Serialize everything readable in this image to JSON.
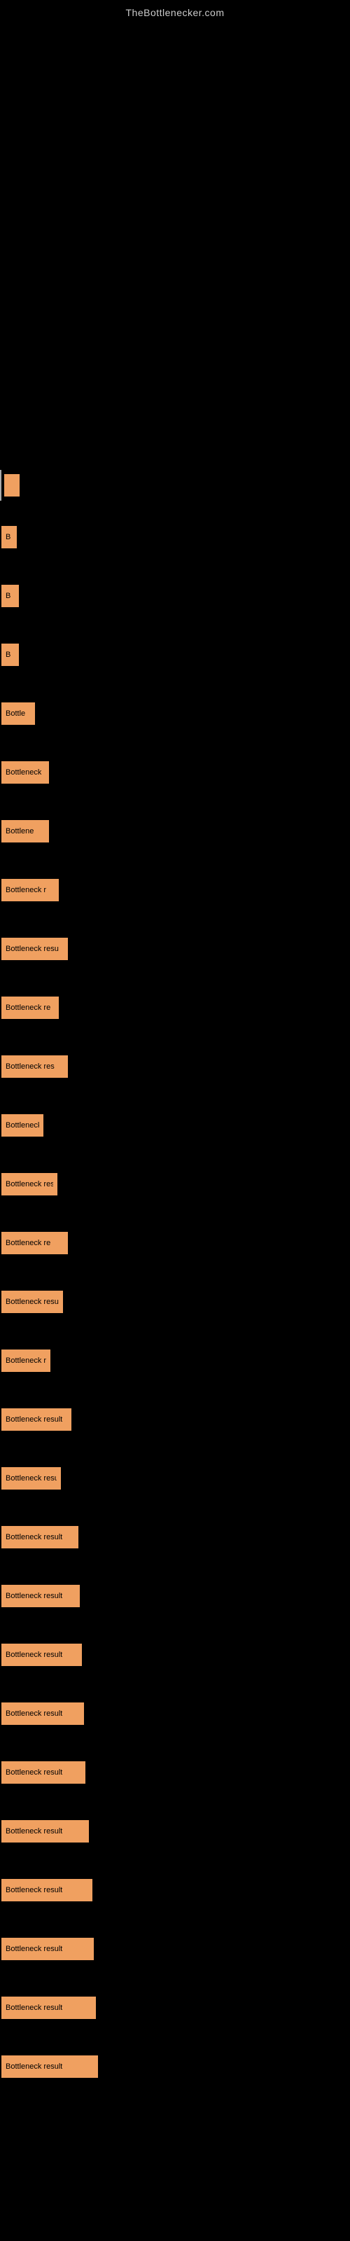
{
  "site": {
    "title": "TheBottlenecker.com"
  },
  "results": [
    {
      "id": 1,
      "label": "",
      "bar_class": "bar-w-1",
      "has_line": true,
      "spacer_before": 640
    },
    {
      "id": 2,
      "label": "B",
      "bar_class": "bar-w-1",
      "has_line": false,
      "spacer_before": 30
    },
    {
      "id": 3,
      "label": "B",
      "bar_class": "bar-w-2",
      "has_line": false,
      "spacer_before": 40
    },
    {
      "id": 4,
      "label": "B",
      "bar_class": "bar-w-2",
      "has_line": false,
      "spacer_before": 40
    },
    {
      "id": 5,
      "label": "Bottle",
      "bar_class": "bar-w-4",
      "has_line": false,
      "spacer_before": 40
    },
    {
      "id": 6,
      "label": "Bottleneck",
      "bar_class": "bar-w-5",
      "has_line": false,
      "spacer_before": 40
    },
    {
      "id": 7,
      "label": "Bottlene",
      "bar_class": "bar-w-5",
      "has_line": false,
      "spacer_before": 40
    },
    {
      "id": 8,
      "label": "Bottleneck r",
      "bar_class": "bar-w-7",
      "has_line": false,
      "spacer_before": 40
    },
    {
      "id": 9,
      "label": "Bottleneck resu",
      "bar_class": "bar-w-8",
      "has_line": false,
      "spacer_before": 40
    },
    {
      "id": 10,
      "label": "Bottleneck re",
      "bar_class": "bar-w-7",
      "has_line": false,
      "spacer_before": 40
    },
    {
      "id": 11,
      "label": "Bottleneck res",
      "bar_class": "bar-w-8",
      "has_line": false,
      "spacer_before": 40
    },
    {
      "id": 12,
      "label": "Bottleneck",
      "bar_class": "bar-w-6",
      "has_line": false,
      "spacer_before": 40
    },
    {
      "id": 13,
      "label": "Bottleneck resul",
      "bar_class": "bar-w-9",
      "has_line": false,
      "spacer_before": 40
    },
    {
      "id": 14,
      "label": "Bottleneck re",
      "bar_class": "bar-w-8",
      "has_line": false,
      "spacer_before": 40
    },
    {
      "id": 15,
      "label": "Bottleneck result",
      "bar_class": "bar-w-10",
      "has_line": false,
      "spacer_before": 40
    },
    {
      "id": 16,
      "label": "Bottleneck result",
      "bar_class": "bar-w-11",
      "has_line": false,
      "spacer_before": 40
    },
    {
      "id": 17,
      "label": "Bottleneck result",
      "bar_class": "bar-w-12",
      "has_line": false,
      "spacer_before": 40
    },
    {
      "id": 18,
      "label": "Bottleneck result",
      "bar_class": "bar-w-13",
      "has_line": false,
      "spacer_before": 40
    },
    {
      "id": 19,
      "label": "Bottleneck result",
      "bar_class": "bar-w-14",
      "has_line": false,
      "spacer_before": 40
    },
    {
      "id": 20,
      "label": "Bottleneck result",
      "bar_class": "bar-w-15",
      "has_line": false,
      "spacer_before": 40
    },
    {
      "id": 21,
      "label": "Bottleneck result",
      "bar_class": "bar-w-16",
      "has_line": false,
      "spacer_before": 40
    },
    {
      "id": 22,
      "label": "Bottleneck result",
      "bar_class": "bar-w-17",
      "has_line": false,
      "spacer_before": 40
    },
    {
      "id": 23,
      "label": "Bottleneck result",
      "bar_class": "bar-w-18",
      "has_line": false,
      "spacer_before": 40
    },
    {
      "id": 24,
      "label": "Bottleneck result",
      "bar_class": "bar-w-20",
      "has_line": false,
      "spacer_before": 40
    },
    {
      "id": 25,
      "label": "Bottleneck result",
      "bar_class": "bar-w-22",
      "has_line": false,
      "spacer_before": 40
    },
    {
      "id": 26,
      "label": "Bottleneck result",
      "bar_class": "bar-w-23",
      "has_line": false,
      "spacer_before": 40
    },
    {
      "id": 27,
      "label": "Bottleneck result",
      "bar_class": "bar-w-24",
      "has_line": false,
      "spacer_before": 40
    },
    {
      "id": 28,
      "label": "Bottleneck result",
      "bar_class": "bar-w-25",
      "has_line": false,
      "spacer_before": 40
    }
  ]
}
